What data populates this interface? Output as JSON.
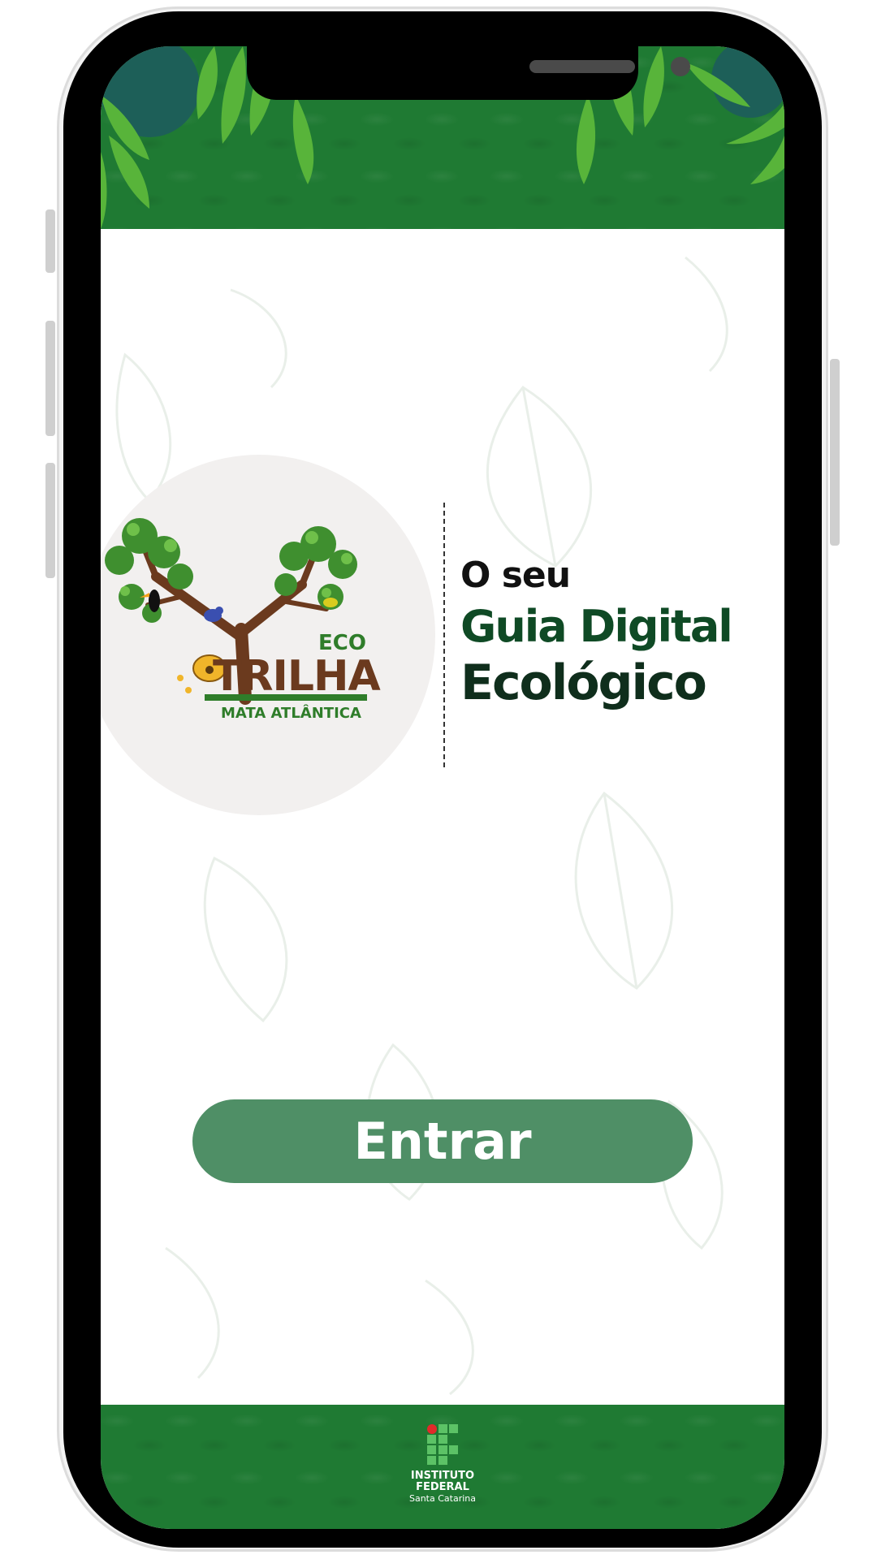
{
  "app": {
    "logo": {
      "top_word": "ECO",
      "main_word": "TRILHA",
      "subtitle": "MATA ATLÂNTICA"
    },
    "tagline": {
      "line1": "O seu",
      "line2": "Guia Digital",
      "line3": "Ecológico"
    },
    "enter_button_label": "Entrar",
    "footer_logo": {
      "line1": "INSTITUTO",
      "line2": "FEDERAL",
      "line3": "Santa Catarina"
    }
  },
  "colors": {
    "band_green": "#1f7a33",
    "button_green": "#4f8f66",
    "tagline_dark_green": "#0f4a25",
    "logo_brown": "#6b3a1e",
    "logo_green": "#2f7d2a"
  },
  "icons": [
    "tree-logo-icon",
    "toucan-icon",
    "bird-icon",
    "beehive-icon",
    "ifsc-logo-icon"
  ]
}
